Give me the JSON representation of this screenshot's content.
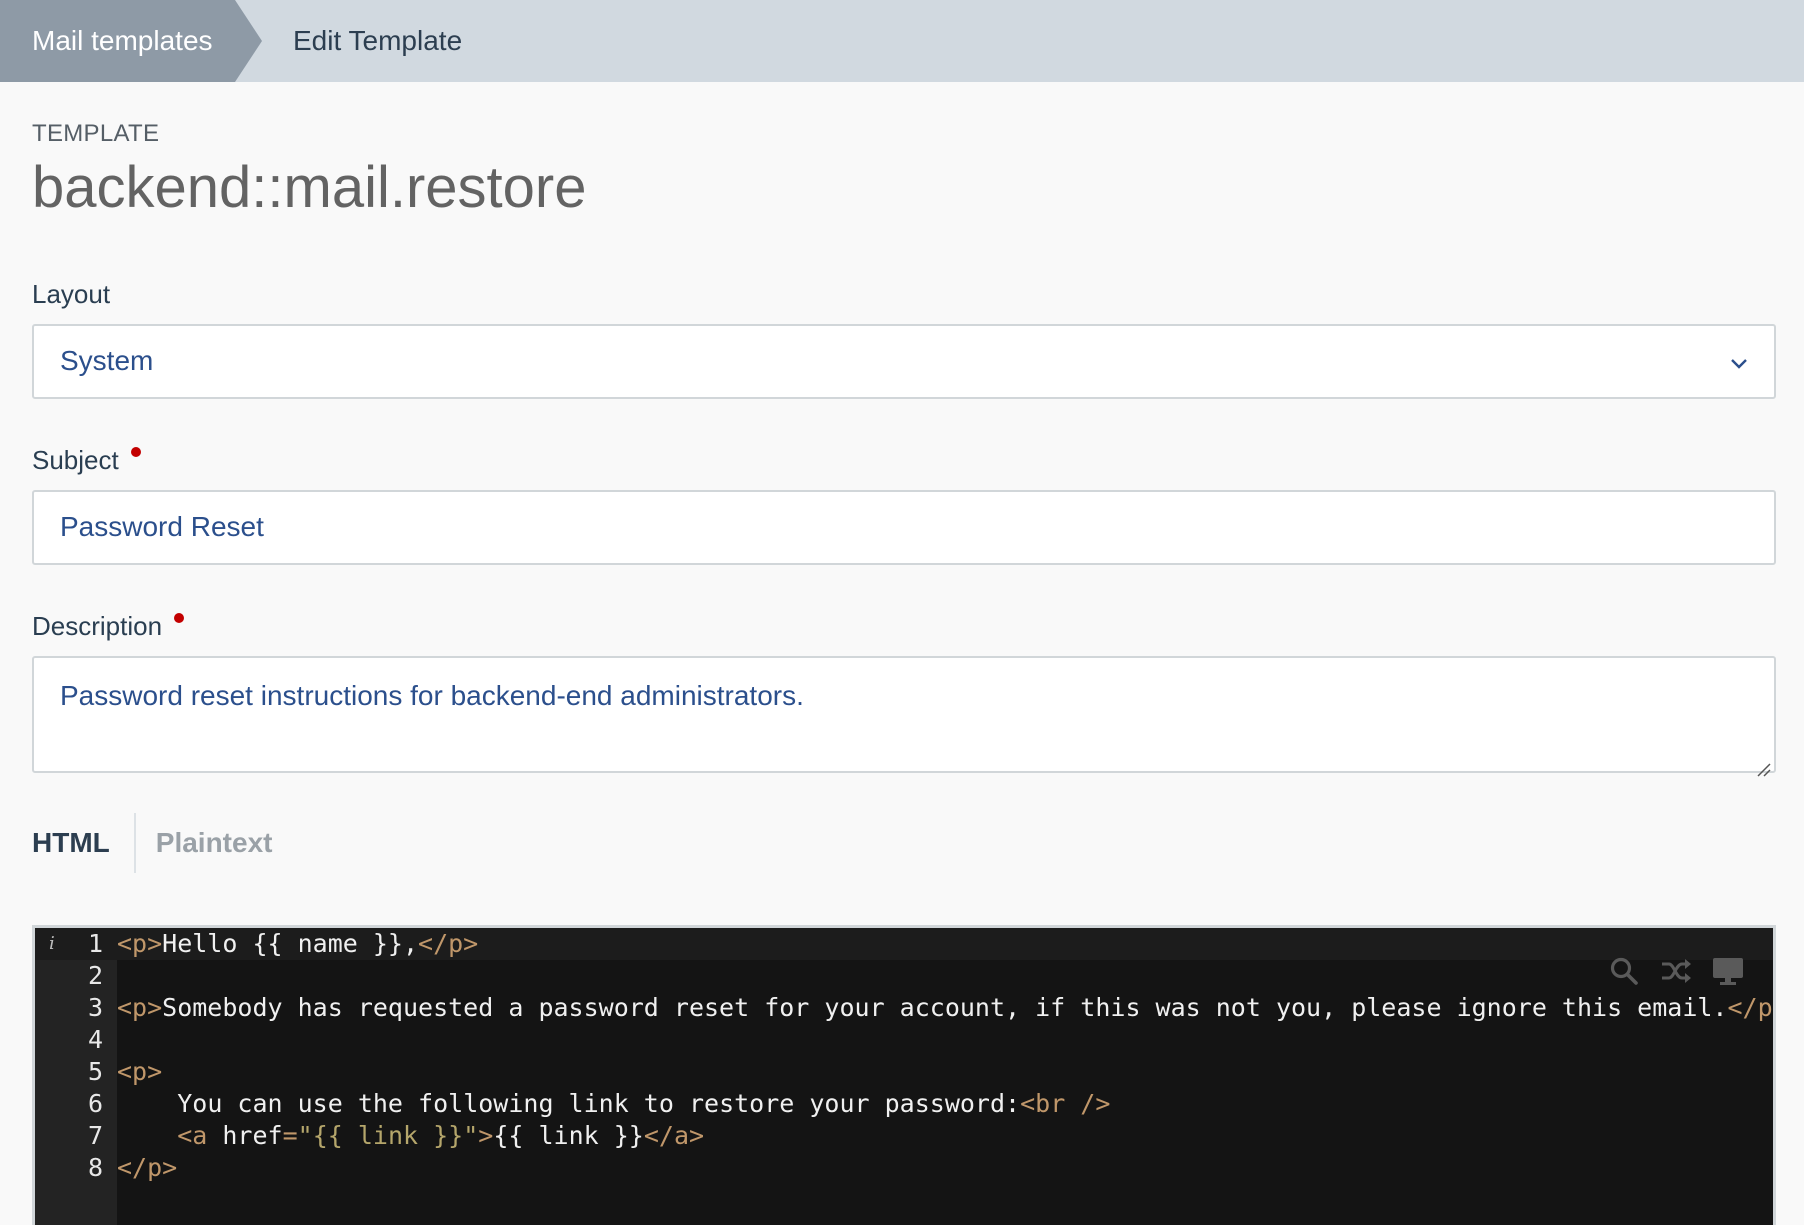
{
  "breadcrumb": {
    "parent": "Mail templates",
    "current": "Edit Template"
  },
  "template": {
    "label": "TEMPLATE",
    "name": "backend::mail.restore"
  },
  "form": {
    "layout": {
      "label": "Layout",
      "value": "System"
    },
    "subject": {
      "label": "Subject",
      "value": "Password Reset",
      "required": true
    },
    "description": {
      "label": "Description",
      "value": "Password reset instructions for backend-end administrators.",
      "required": true
    }
  },
  "tabs": [
    {
      "label": "HTML",
      "active": true
    },
    {
      "label": "Plaintext",
      "active": false
    }
  ],
  "editor": {
    "lines": [
      {
        "num": "1"
      },
      {
        "num": "2"
      },
      {
        "num": "3"
      },
      {
        "num": "4"
      },
      {
        "num": "5"
      },
      {
        "num": "6"
      },
      {
        "num": "7"
      },
      {
        "num": "8"
      }
    ],
    "code": {
      "l1_open": "<p>",
      "l1_text": "Hello {{ name }},",
      "l1_close": "</p>",
      "l3_open": "<p>",
      "l3_text": "Somebody has requested a password reset for your account, if this was not you, please ignore this email.",
      "l3_close": "</p>",
      "l5_open": "<p>",
      "l6_indent": "    ",
      "l6_text": "You can use the following link to restore your password:",
      "l6_br": "<br />",
      "l7_indent": "    ",
      "l7_a_open": "<a",
      "l7_attr": " href",
      "l7_eq": "=",
      "l7_val": "\"{{ link }}\"",
      "l7_gt": ">",
      "l7_text": "{{ link }}",
      "l7_a_close": "</a>",
      "l8_close": "</p>"
    },
    "info_marker": "i",
    "tools": [
      "search-icon",
      "shuffle-icon",
      "fullscreen-icon"
    ]
  },
  "colors": {
    "breadcrumb_bg": "#d1d9e0",
    "breadcrumb_active_bg": "#8e9aa6",
    "required_dot": "#c30000",
    "input_text": "#2b4f8c",
    "editor_bg": "#141414",
    "tag": "#c0976a",
    "string": "#b5a66b"
  }
}
